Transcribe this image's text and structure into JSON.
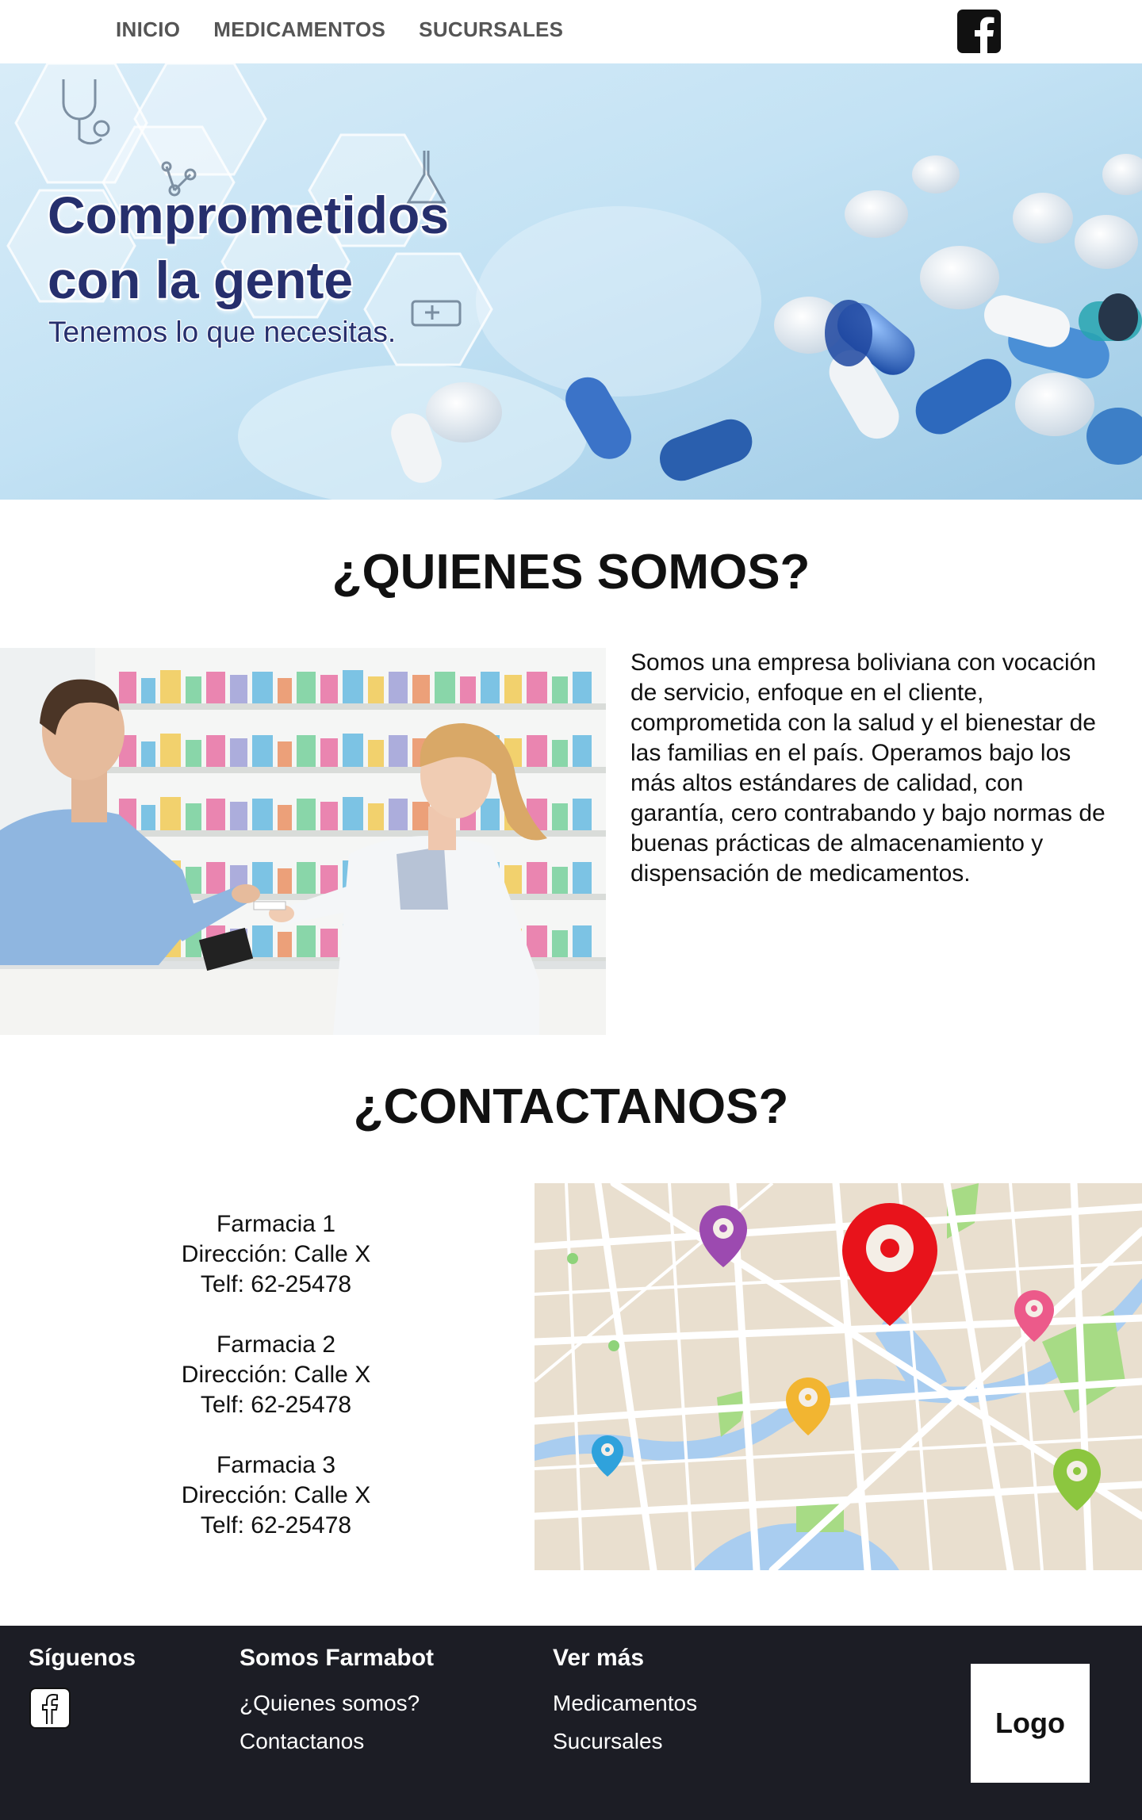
{
  "nav": {
    "links": [
      "INICIO",
      "MEDICAMENTOS",
      "SUCURSALES"
    ],
    "facebook_icon": "facebook-icon"
  },
  "hero": {
    "title_line1": "Comprometidos",
    "title_line2": "con la gente",
    "subtitle": "Tenemos lo que necesitas."
  },
  "about": {
    "title": "¿QUIENES SOMOS?",
    "text": "Somos una empresa boliviana con vocación de servicio, enfoque en el cliente, comprometida con la salud y el bienestar de las familias en el país. Operamos bajo los más altos estándares de calidad, con garantía, cero contrabando y bajo normas de buenas prácticas de almacenamiento y dispensación de medicamentos."
  },
  "contact": {
    "title": "¿CONTACTANOS?",
    "pharmacies": [
      {
        "name": "Farmacia 1",
        "address": "Dirección: Calle X",
        "phone": "Telf: 62-25478"
      },
      {
        "name": "Farmacia 2",
        "address": "Dirección: Calle X",
        "phone": "Telf: 62-25478"
      },
      {
        "name": "Farmacia 3",
        "address": "Dirección: Calle X",
        "phone": "Telf: 62-25478"
      }
    ]
  },
  "footer": {
    "follow_heading": "Síguenos",
    "about_heading": "Somos Farmabot",
    "about_links": [
      "¿Quienes somos?",
      "Contactanos"
    ],
    "more_heading": "Ver más",
    "more_links": [
      "Medicamentos",
      "Sucursales"
    ],
    "logo_text": "Logo"
  },
  "colors": {
    "hero_title": "#262f6d",
    "footer_bg": "#1c1d25",
    "nav_text": "#555555",
    "map_bg": "#e9dfcf",
    "map_water": "#a9cdf0",
    "main_pin": "#e8131b"
  }
}
